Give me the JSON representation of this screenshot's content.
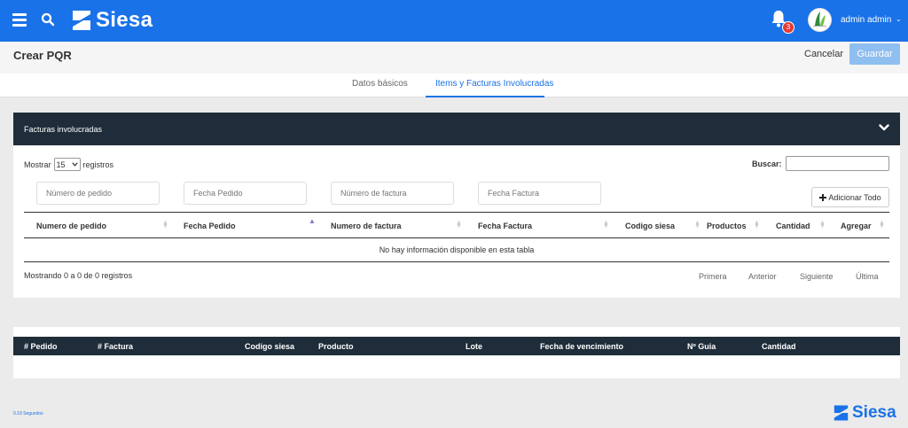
{
  "header": {
    "brand": "Siesa",
    "notifications_count": "3",
    "user_name": "admin admin"
  },
  "subheader": {
    "title": "Crear PQR",
    "cancel_label": "Cancelar",
    "save_label": "Guardar"
  },
  "tabs": [
    {
      "label": "Datos básicos"
    },
    {
      "label": "Items y Facturas Involucradas"
    }
  ],
  "facturas": {
    "title": "Facturas involucradas",
    "show_prefix": "Mostrar",
    "show_value": "15",
    "show_suffix": "registros",
    "search_label": "Buscar:",
    "filters": [
      {
        "placeholder": "Número de pedido"
      },
      {
        "placeholder": "Fecha Pedido"
      },
      {
        "placeholder": "Número de factura"
      },
      {
        "placeholder": "Fecha Factura"
      }
    ],
    "add_all_label": "Adicionar Todo",
    "columns": [
      "Numero de pedido",
      "Fecha Pedido",
      "Numero de factura",
      "Fecha Factura",
      "Codigo siesa",
      "Productos",
      "Cantidad",
      "Agregar"
    ],
    "empty_message": "No hay información disponible en esta tabla",
    "info": "Mostrando 0 a 0 de 0 registros",
    "pager": [
      "Primera",
      "Anterior",
      "Siguiente",
      "Última"
    ]
  },
  "items_table": {
    "columns": [
      "# Pedido",
      "# Factura",
      "Codigo siesa",
      "Producto",
      "Lote",
      "Fecha de vencimiento",
      "Nº Guia",
      "Cantidad"
    ]
  },
  "footer": {
    "timing": "0.19 Segundos",
    "brand": "Siesa"
  },
  "colors": {
    "primary": "#1a72e8",
    "dark_header": "#1f2d3a",
    "save_button": "#8fbef0",
    "badge": "#e53935"
  }
}
